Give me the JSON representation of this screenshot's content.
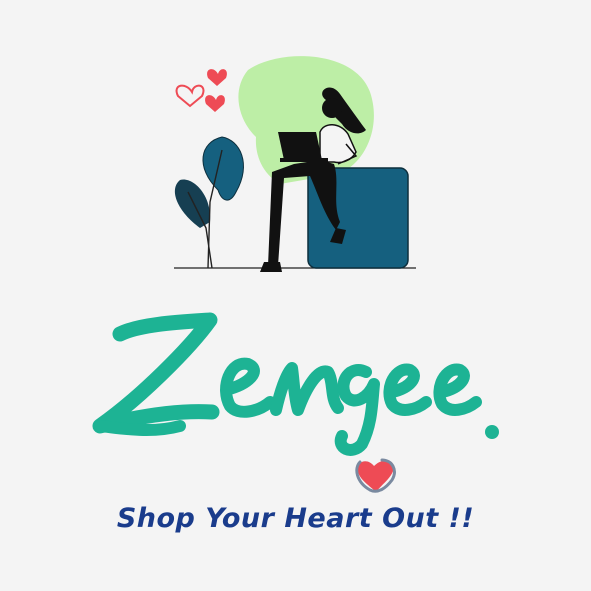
{
  "brand": {
    "wordmark": "Zengee.",
    "tagline": "Shop Your Heart Out !!"
  },
  "colors": {
    "background": "#f4f4f4",
    "wordmark_teal": "#1db394",
    "tagline_navy": "#1a3c8c",
    "heart_red": "#ee4b55",
    "box_blue": "#15607f",
    "blob_green": "#bdeea6",
    "figure_black": "#111111"
  },
  "icons": [
    "hearts-icon",
    "plant-icon",
    "laptop-icon",
    "heart-icon"
  ]
}
